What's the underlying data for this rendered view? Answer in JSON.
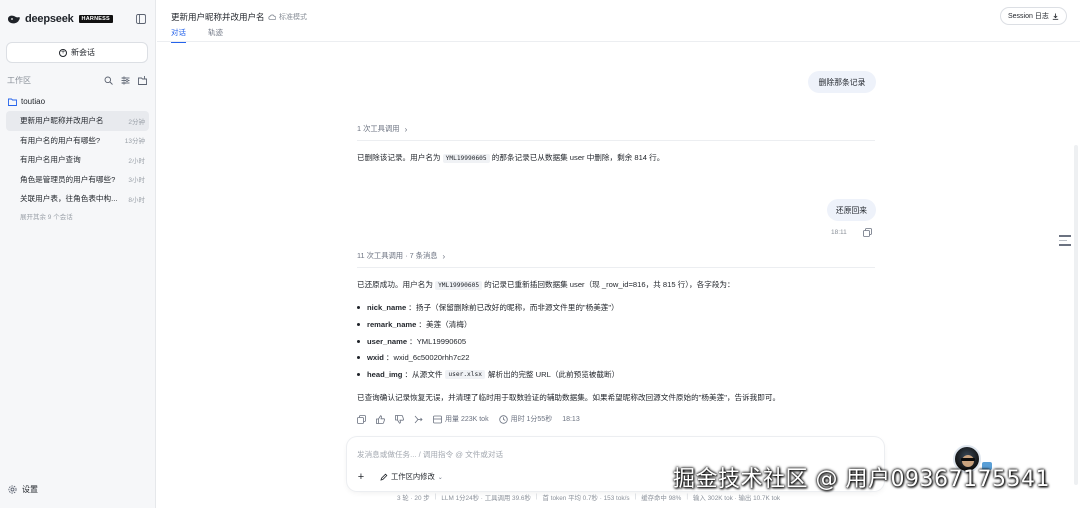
{
  "brand": {
    "name": "deepseek",
    "badge": "HARNESS"
  },
  "sidebar": {
    "new_chat": "新会话",
    "workspace_label": "工作区",
    "folder": "toutiao",
    "sessions": [
      {
        "title": "更新用户昵称并改用户名",
        "time": "2分钟"
      },
      {
        "title": "有用户名的用户有哪些?",
        "time": "13分钟"
      },
      {
        "title": "有用户名用户查询",
        "time": "2小时"
      },
      {
        "title": "角色是管理员的用户有哪些?",
        "time": "3小时"
      },
      {
        "title": "关联用户表，往角色表中构...",
        "time": "8小时"
      }
    ],
    "expand_more": "展开其余 9 个会话",
    "settings": "设置"
  },
  "header": {
    "title": "更新用户昵称并改用户名",
    "mode": "标准模式",
    "tabs": [
      "对话",
      "轨迹"
    ],
    "session_log": "Session 日志"
  },
  "chat": {
    "user_msg_1": "删除那条记录",
    "tool_calls_1": "1 次工具调用",
    "reply_1_a": "已删除该记录。用户名为",
    "reply_1_code": "YML19990605",
    "reply_1_b": "的那条记录已从数据集 user 中删除，剩余 814 行。",
    "user_msg_2": "还原回来",
    "user_msg_2_time": "18:11",
    "tool_calls_2": "11 次工具调用 · 7 条消息",
    "reply_2_a": "已还原成功。用户名为",
    "reply_2_code": "YML19990605",
    "reply_2_b": "的记录已重新插回数据集 user（现 _row_id=816，共 815 行），各字段为：",
    "fields": [
      {
        "key": "nick_name",
        "value": "扬子（保留删除前已改好的昵称，而非源文件里的\"杨美莲\"）"
      },
      {
        "key": "remark_name",
        "value": "美莲（清梅）"
      },
      {
        "key": "user_name",
        "value": "YML19990605"
      },
      {
        "key": "wxid",
        "value": "wxid_6c50020rhh7c22"
      }
    ],
    "head_img_key": "head_img",
    "head_img_a": "从源文件",
    "head_img_code": "user.xlsx",
    "head_img_b": "解析出的完整 URL（此前预览被截断）",
    "reply_2_footer": "已查询确认记录恢复无误，并清理了临时用于取数验证的辅助数据集。如果希望昵称改回源文件原始的\"杨美莲\"，告诉我即可。",
    "token_usage": "用量 223K tok",
    "duration": "用时 1分55秒",
    "reply_time": "18:13"
  },
  "composer": {
    "placeholder": "发消息或做任务... / 调用指令 @ 文件或对话",
    "scope": "工作区内修改"
  },
  "statusbar": [
    "3 轮 · 20 步",
    "LLM 1分24秒 · 工具调用 39.6秒",
    "首 token 平均 0.7秒 · 153 tok/s",
    "缓存命中 98%",
    "输入 302K tok · 输出 10.7K tok"
  ],
  "watermark": "掘金技术社区 @ 用户0936717554​1",
  "colors": {
    "accent": "#2563eb",
    "bubble": "#eef2fa",
    "sidebar_bg": "#f6f7f9"
  }
}
